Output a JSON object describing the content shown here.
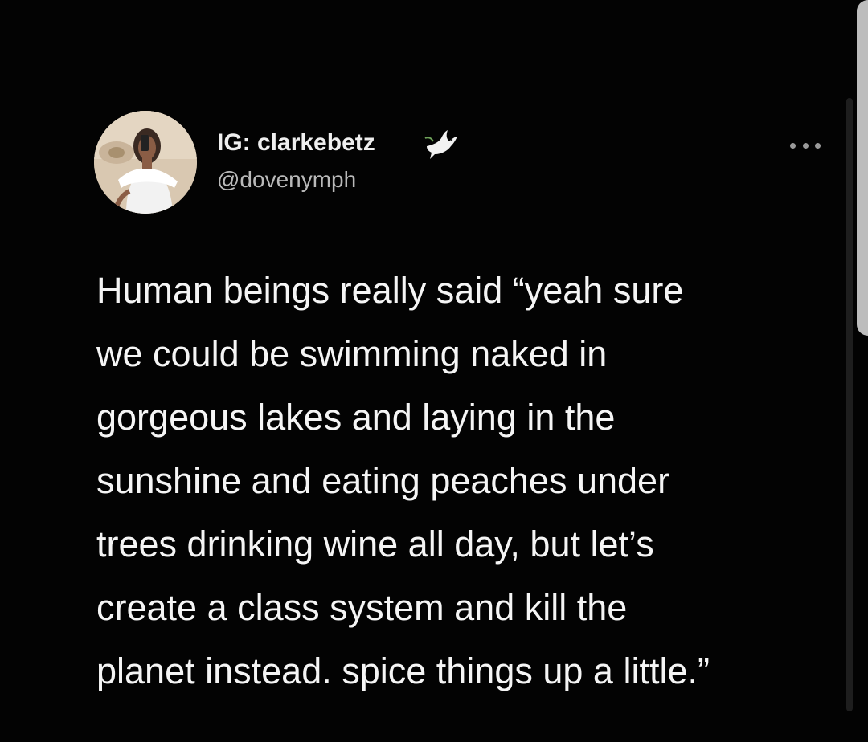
{
  "tweet": {
    "display_name": "IG: clarkebetz",
    "handle": "@dovenymph",
    "name_emoji_icon": "dove-icon",
    "more_icon": "more-horizontal-icon",
    "text_lines": [
      "Human beings really said “yeah sure",
      "we could be swimming naked in",
      "gorgeous lakes and laying in the",
      "sunshine and eating peaches under",
      "trees drinking wine all day, but let’s",
      "create a class system and kill the",
      "planet instead. spice things up a little.”"
    ]
  },
  "colors": {
    "background": "#030303",
    "primary_text": "#f5f5f5",
    "secondary_text": "#b9b9b9",
    "scrollbar": "#bdbdbd"
  }
}
